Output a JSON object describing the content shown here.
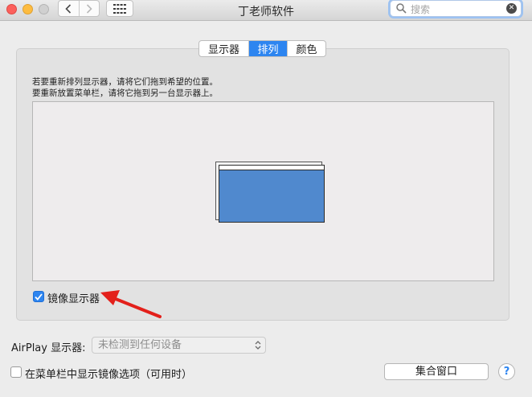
{
  "window": {
    "title": "丁老师软件"
  },
  "toolbar": {
    "search_placeholder": "搜索"
  },
  "tabs": [
    {
      "label": "显示器",
      "active": false
    },
    {
      "label": "排列",
      "active": true
    },
    {
      "label": "颜色",
      "active": false
    }
  ],
  "arrangement": {
    "instruction_line1": "若要重新排列显示器，请将它们拖到希望的位置。",
    "instruction_line2": "要重新放置菜单栏，请将它拖到另一台显示器上。",
    "mirror_label": "镜像显示器",
    "mirror_checked": true
  },
  "airplay": {
    "label": "AirPlay 显示器:",
    "selected": "未检测到任何设备"
  },
  "menubar_option": {
    "label": "在菜单栏中显示镜像选项（可用时）",
    "checked": false
  },
  "buttons": {
    "gather_windows": "集合窗口",
    "help": "?"
  },
  "colors": {
    "accent": "#2d85f0",
    "display_fill": "#5089ce",
    "arrow": "#e3201b"
  },
  "icons": {
    "back": "chevron-left-icon",
    "forward": "chevron-right-icon",
    "grid": "grid-icon",
    "search": "search-icon",
    "clear": "clear-icon"
  }
}
